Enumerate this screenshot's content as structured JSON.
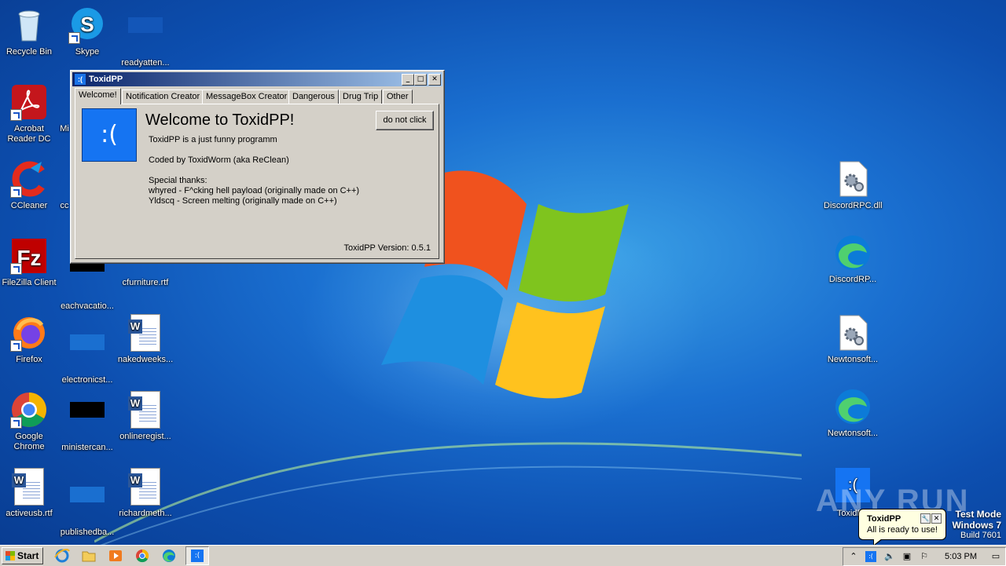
{
  "desktop": {
    "icons": {
      "recycle_bin": "Recycle Bin",
      "skype": "Skype",
      "readyatten": "readyatten...",
      "acrobat": "Acrobat Reader DC",
      "micro": "Mi",
      "ccleaner": "CCleaner",
      "co": "cc",
      "filezilla": "FileZilla Client",
      "eachvacation": "eachvacatio...",
      "cfurniture": "cfurniture.rtf",
      "firefox": "Firefox",
      "electronicst": "electronicst...",
      "nakedweeks": "nakedweeks...",
      "chrome": "Google Chrome",
      "ministercan": "ministercan...",
      "onlineregist": "onlineregist...",
      "activeusb": "activeusb.rtf",
      "publishedba": "publishedba...",
      "richardmeth": "richardmeth...",
      "discordrpc_dll": "DiscordRPC.dll",
      "discordrp_edge": "DiscordRP...",
      "newtonsoft_dll": "Newtonsoft...",
      "newtonsoft_edge": "Newtonsoft...",
      "toxidpp": "ToxidPP"
    }
  },
  "window": {
    "title": "ToxidPP",
    "icon_glyph": ":(",
    "tabs": [
      "Welcome!",
      "Notification Creator",
      "MessageBox Creator",
      "Dangerous",
      "Drug Trip",
      "Other"
    ],
    "sad_face": ":(",
    "heading": "Welcome to ToxidPP!",
    "line1": "ToxidPP is a just funny programm",
    "line2": "Coded by ToxidWorm (aka ReClean)",
    "thanks_title": "Special thanks:",
    "thanks1": "whyred - F^cking hell payload (originally made on C++)",
    "thanks2": "Yldscq - Screen melting (originally made on C++)",
    "button": "do not click",
    "version": "ToxidPP Version: 0.5.1"
  },
  "taskbar": {
    "start": "Start",
    "clock": "5:03 PM"
  },
  "balloon": {
    "title": "ToxidPP",
    "message": "All is ready to use!"
  },
  "watermark": "ANY RUN",
  "testmode": {
    "line1": "Test Mode",
    "line2": "Windows 7",
    "line3": "Build 7601"
  },
  "colors": {
    "window_face": "#d4d0c8",
    "title_gradient_start": "#0a246a",
    "title_gradient_end": "#a6caf0",
    "bsod_blue": "#1574f2"
  }
}
